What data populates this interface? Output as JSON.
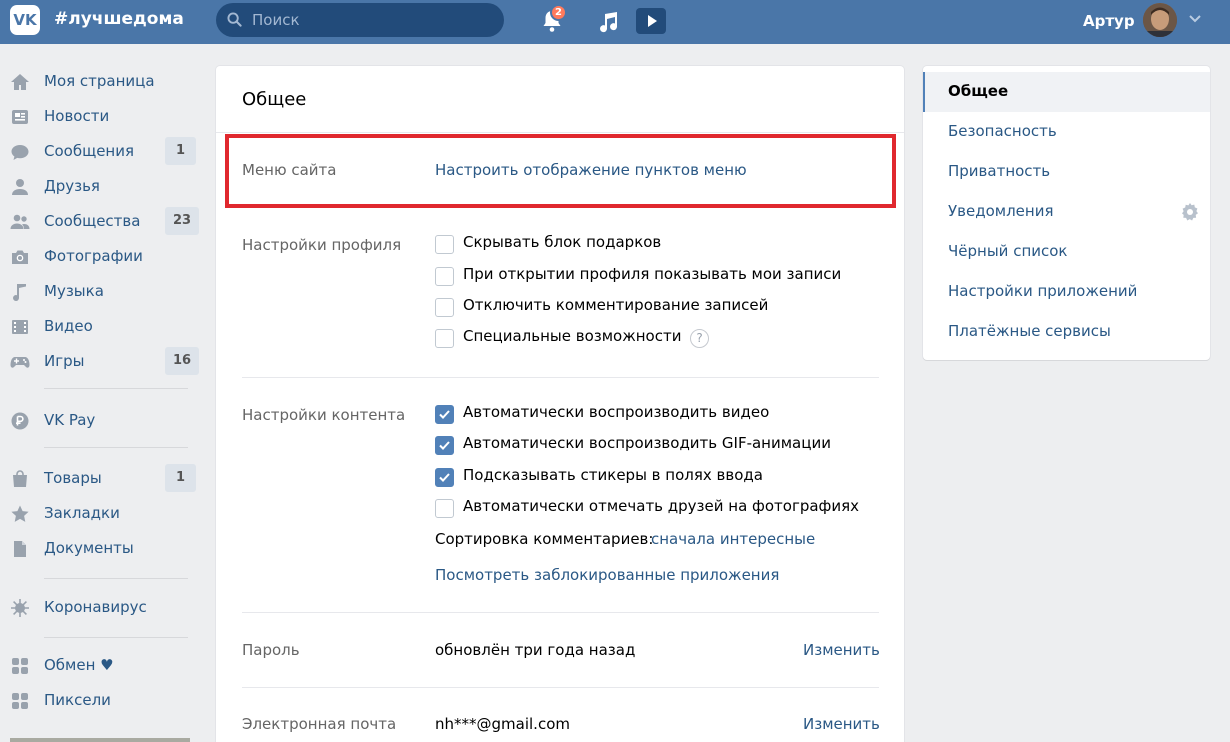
{
  "header": {
    "logo": "VK",
    "hashtag": "#лучшедома",
    "search_placeholder": "Поиск",
    "notifications_count": "2",
    "user_name": "Артур"
  },
  "sidebar": {
    "items": [
      {
        "label": "Моя страница",
        "icon": "home-icon",
        "count": ""
      },
      {
        "label": "Новости",
        "icon": "news-icon",
        "count": ""
      },
      {
        "label": "Сообщения",
        "icon": "messages-icon",
        "count": "1"
      },
      {
        "label": "Друзья",
        "icon": "friends-icon",
        "count": ""
      },
      {
        "label": "Сообщества",
        "icon": "communities-icon",
        "count": "23"
      },
      {
        "label": "Фотографии",
        "icon": "camera-icon",
        "count": ""
      },
      {
        "label": "Музыка",
        "icon": "music-icon",
        "count": ""
      },
      {
        "label": "Видео",
        "icon": "video-icon",
        "count": ""
      },
      {
        "label": "Игры",
        "icon": "gamepad-icon",
        "count": "16"
      },
      {
        "label": "VK Pay",
        "icon": "vkpay-icon",
        "count": ""
      },
      {
        "label": "Товары",
        "icon": "bag-icon",
        "count": "1"
      },
      {
        "label": "Закладки",
        "icon": "star-icon",
        "count": ""
      },
      {
        "label": "Документы",
        "icon": "document-icon",
        "count": ""
      },
      {
        "label": "Коронавирус",
        "icon": "virus-icon",
        "count": ""
      },
      {
        "label": "Обмен ♥",
        "icon": "apps-icon",
        "count": ""
      },
      {
        "label": "Пиксели",
        "icon": "apps-icon",
        "count": ""
      }
    ]
  },
  "main": {
    "title": "Общее",
    "site_menu": {
      "label": "Меню сайта",
      "link": "Настроить отображение пунктов меню"
    },
    "profile_settings": {
      "label": "Настройки профиля",
      "options": [
        {
          "label": "Скрывать блок подарков",
          "checked": false
        },
        {
          "label": "При открытии профиля показывать мои записи",
          "checked": false
        },
        {
          "label": "Отключить комментирование записей",
          "checked": false
        },
        {
          "label": "Специальные возможности",
          "checked": false
        }
      ],
      "help": "?"
    },
    "content_settings": {
      "label": "Настройки контента",
      "options": [
        {
          "label": "Автоматически воспроизводить видео",
          "checked": true
        },
        {
          "label": "Автоматически воспроизводить GIF-анимации",
          "checked": true
        },
        {
          "label": "Подсказывать стикеры в полях ввода",
          "checked": true
        },
        {
          "label": "Автоматически отмечать друзей на фотографиях",
          "checked": false
        }
      ],
      "sort_label": "Сортировка комментариев:",
      "sort_value": "сначала интересные",
      "blocked_apps_link": "Посмотреть заблокированные приложения"
    },
    "password": {
      "label": "Пароль",
      "value": "обновлён три года назад",
      "action": "Изменить"
    },
    "email": {
      "label": "Электронная почта",
      "value": "nh***@gmail.com",
      "action": "Изменить"
    }
  },
  "settings_menu": {
    "items": [
      {
        "label": "Общее",
        "active": true
      },
      {
        "label": "Безопасность",
        "active": false
      },
      {
        "label": "Приватность",
        "active": false
      },
      {
        "label": "Уведомления",
        "active": false
      },
      {
        "label": "Чёрный список",
        "active": false
      },
      {
        "label": "Настройки приложений",
        "active": false
      },
      {
        "label": "Платёжные сервисы",
        "active": false
      }
    ]
  }
}
